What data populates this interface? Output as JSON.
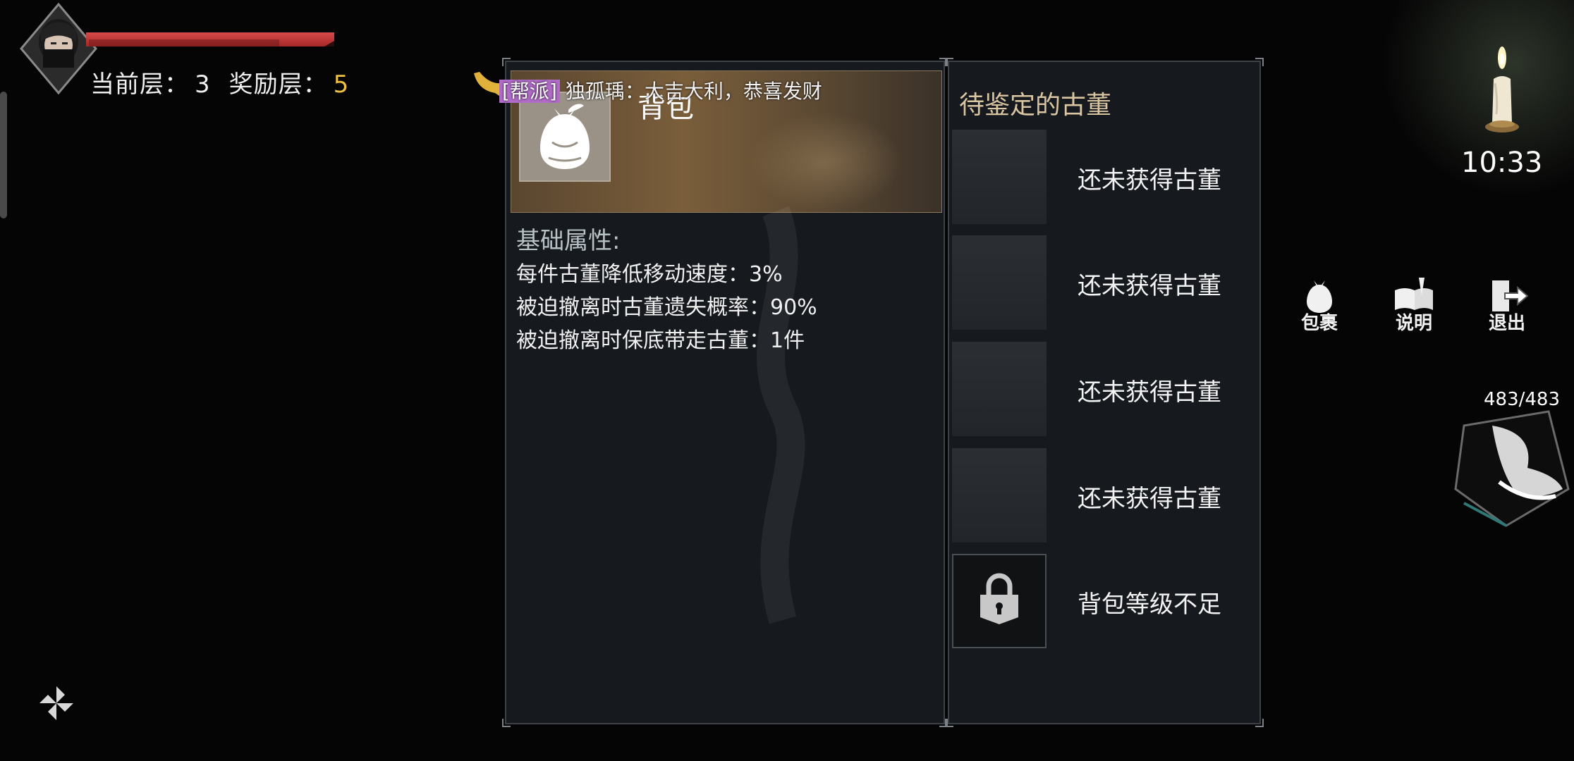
{
  "hud": {
    "current_floor_label": "当前层：",
    "current_floor_value": "3",
    "reward_floor_label": "奖励层：",
    "reward_floor_value": "5",
    "hp_fraction": 1.0
  },
  "chat": {
    "channel_tag": "[帮派]",
    "message": "独孤瑀：大吉大利，恭喜发财"
  },
  "bag_panel": {
    "title": "背包",
    "attributes_heading": "基础属性:",
    "attributes": [
      "每件古董降低移动速度：3%",
      "被迫撤离时古董遗失概率：90%",
      "被迫撤离时保底带走古董：1件"
    ]
  },
  "antique_panel": {
    "heading": "待鉴定的古董",
    "slots": [
      {
        "label": "还未获得古董",
        "locked": false
      },
      {
        "label": "还未获得古董",
        "locked": false
      },
      {
        "label": "还未获得古董",
        "locked": false
      },
      {
        "label": "还未获得古董",
        "locked": false
      },
      {
        "label": "背包等级不足",
        "locked": true
      }
    ]
  },
  "top_right": {
    "clock": "10:33"
  },
  "side_buttons": {
    "bag": "包裹",
    "help": "说明",
    "exit": "退出"
  },
  "skill": {
    "energy": "483/483"
  },
  "colors": {
    "reward_accent": "#f0c040",
    "hp_bar": "#c83a3a",
    "panel_bg": "#161a1e",
    "heading_gold": "#d9c5a1",
    "chat_tag": "#b06cc8"
  },
  "icons": [
    "ninja-avatar-icon",
    "bag-icon",
    "candle-icon",
    "help-icon",
    "exit-icon",
    "lock-icon",
    "pinwheel-icon",
    "chat-horn-icon",
    "skill-icon"
  ]
}
